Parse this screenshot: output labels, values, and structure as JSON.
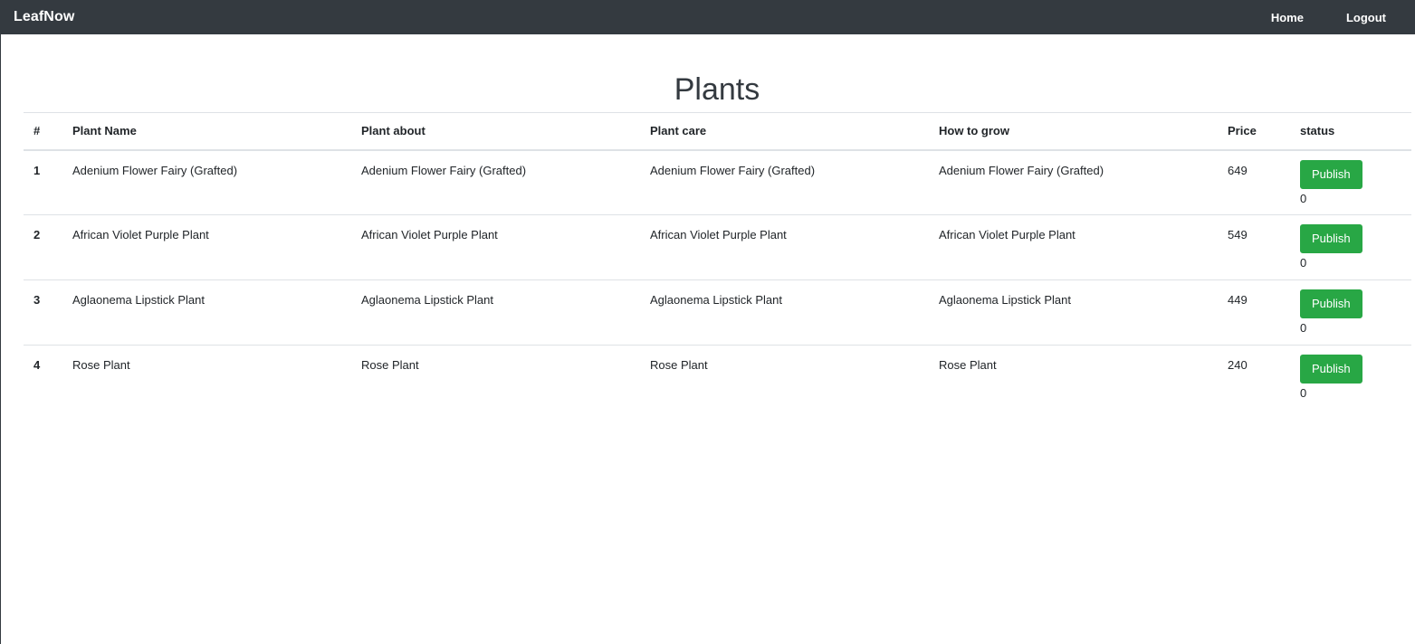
{
  "navbar": {
    "brand": "LeafNow",
    "links": [
      "Home",
      "Logout"
    ]
  },
  "page": {
    "title": "Plants"
  },
  "table": {
    "headers": [
      "#",
      "Plant Name",
      "Plant about",
      "Plant care",
      "How to grow",
      "Price",
      "status"
    ],
    "rows": [
      {
        "num": "1",
        "name": "Adenium Flower Fairy (Grafted)",
        "about": "Adenium Flower Fairy (Grafted)",
        "care": "Adenium Flower Fairy (Grafted)",
        "grow": "Adenium Flower Fairy (Grafted)",
        "price": "649",
        "button": "Publish",
        "count": "0"
      },
      {
        "num": "2",
        "name": "African Violet Purple Plant",
        "about": "African Violet Purple Plant",
        "care": "African Violet Purple Plant",
        "grow": "African Violet Purple Plant",
        "price": "549",
        "button": "Publish",
        "count": "0"
      },
      {
        "num": "3",
        "name": "Aglaonema Lipstick Plant",
        "about": "Aglaonema Lipstick Plant",
        "care": "Aglaonema Lipstick Plant",
        "grow": "Aglaonema Lipstick Plant",
        "price": "449",
        "button": "Publish",
        "count": "0"
      },
      {
        "num": "4",
        "name": "Rose Plant",
        "about": "Rose Plant",
        "care": "Rose Plant",
        "grow": "Rose Plant",
        "price": "240",
        "button": "Publish",
        "count": "0"
      }
    ]
  },
  "colors": {
    "navbar": "#343a40",
    "publish_button": "#28a745"
  }
}
